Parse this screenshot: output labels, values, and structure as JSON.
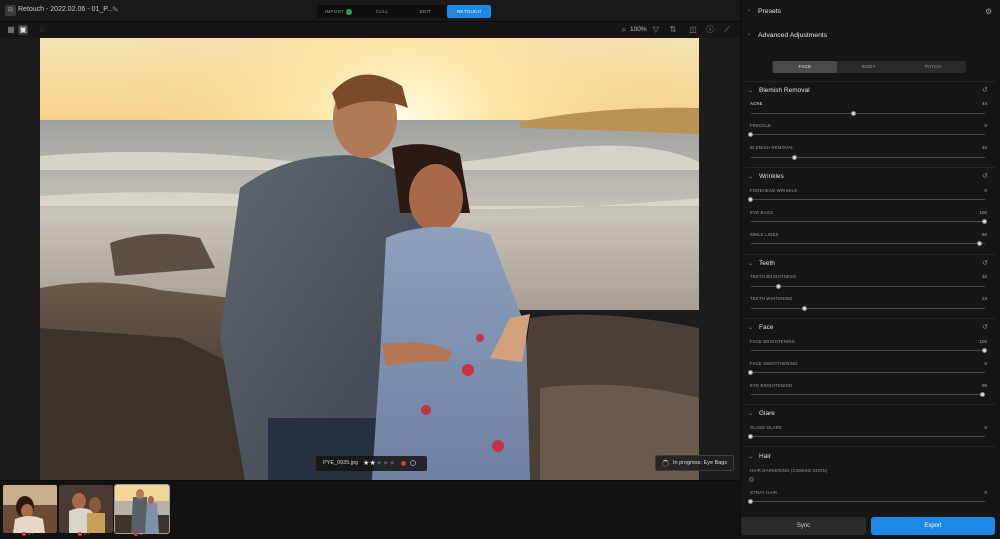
{
  "topbar": {
    "app_logo_icon": "retouch-logo-icon",
    "title": "Retouch - 2022.02.06 - 01_P...",
    "edit_icon": "pencil-icon",
    "steps": [
      {
        "label": "IMPORT",
        "state": "done"
      },
      {
        "label": "CULL",
        "state": "idle"
      },
      {
        "label": "EDIT",
        "state": "idle"
      },
      {
        "label": "RETOUCH",
        "state": "active"
      }
    ]
  },
  "toolbar": {
    "zoom": "100%",
    "left_icons": [
      "grid-view-icon",
      "single-view-icon",
      "info-circle-icon"
    ],
    "right_icons": [
      "zoom-icon",
      "filter-icon",
      "sort-icon",
      "compare-icon",
      "info-icon",
      "eyedropper-icon"
    ]
  },
  "canvas": {
    "file_name": "PYE_0935.jpg",
    "rating": 2,
    "rating_max": 5,
    "progress_text": "In progress: Eye Bags"
  },
  "filmstrip": [
    {
      "meta": "0",
      "selected": false
    },
    {
      "meta": "0",
      "selected": false
    },
    {
      "meta": "2",
      "selected": true
    }
  ],
  "panel": {
    "presets_label": "Presets",
    "advanced_label": "Advanced Adjustments",
    "tabs": [
      {
        "label": "FACE",
        "active": true
      },
      {
        "label": "BODY",
        "active": false
      },
      {
        "label": "PATCH",
        "active": false
      }
    ],
    "sections": [
      {
        "title": "Blemish Removal",
        "sliders": [
          {
            "label": "ACNE",
            "value": "44",
            "level": 0.44,
            "highlight": true
          },
          {
            "label": "FRECKLE",
            "value": "0",
            "level": 0.0
          },
          {
            "label": "BLEMISH REMOVAL",
            "value": "33",
            "level": 0.19
          }
        ]
      },
      {
        "title": "Wrinkles",
        "sliders": [
          {
            "label": "FOREHEAD WRINKLE",
            "value": "0",
            "level": 0.0
          },
          {
            "label": "EYE BAGS",
            "value": "100",
            "level": 1.0
          },
          {
            "label": "SMILE LINES",
            "value": "80",
            "level": 0.98
          }
        ]
      },
      {
        "title": "Teeth",
        "sliders": [
          {
            "label": "TEETH BRIGHTNESS",
            "value": "32",
            "level": 0.12
          },
          {
            "label": "TEETH WHITENING",
            "value": "23",
            "level": 0.23
          }
        ]
      },
      {
        "title": "Face",
        "sliders": [
          {
            "label": "FACE BRIGHTENING",
            "value": "100",
            "level": 1.0
          },
          {
            "label": "FACE SMOOTHENING",
            "value": "0",
            "level": 0.0
          },
          {
            "label": "EYE BRIGHTENING",
            "value": "99",
            "level": 0.99
          }
        ]
      },
      {
        "title": "Glare",
        "sliders": [
          {
            "label": "GLASS GLARE",
            "value": "0",
            "level": 0.0
          }
        ]
      },
      {
        "title": "Hair",
        "sliders": [
          {
            "label": "HAIR DARKENING (COMING SOON)",
            "value": "",
            "level": 0.0,
            "disabled": true
          },
          {
            "label": "STRAY HAIR",
            "value": "0",
            "level": 0.0
          }
        ]
      }
    ],
    "sync_label": "Sync",
    "export_label": "Export"
  },
  "colors": {
    "accent": "#1f87e6",
    "done": "#30a46c",
    "flag_red": "#d13b3b"
  }
}
